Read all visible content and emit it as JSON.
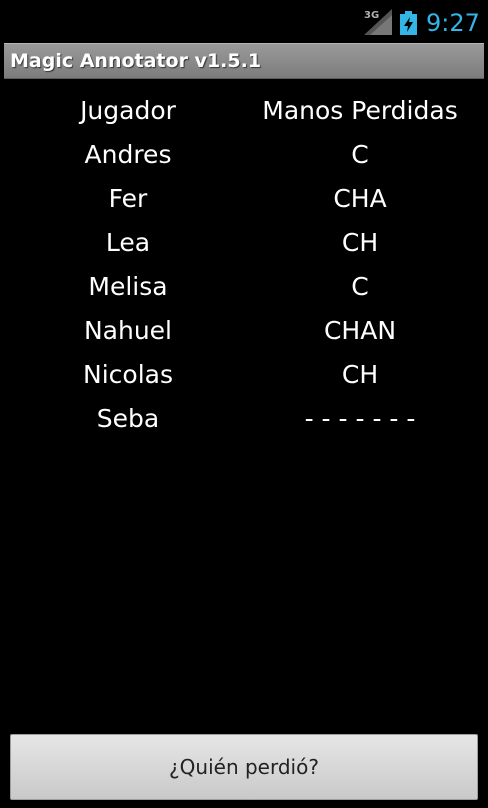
{
  "status_bar": {
    "network": "3G",
    "time": "9:27",
    "icons": [
      "signal-icon",
      "battery-charging-icon"
    ],
    "clock_color": "#33b5e5"
  },
  "app": {
    "title": "Magic Annotator v1.5.1"
  },
  "table": {
    "headers": [
      "Jugador",
      "Manos Perdidas"
    ],
    "rows": [
      {
        "player": "Andres",
        "hands": "C"
      },
      {
        "player": "Fer",
        "hands": "CHA"
      },
      {
        "player": "Lea",
        "hands": "CH"
      },
      {
        "player": "Melisa",
        "hands": "C"
      },
      {
        "player": "Nahuel",
        "hands": "CHAN"
      },
      {
        "player": "Nicolas",
        "hands": "CH"
      },
      {
        "player": "Seba",
        "hands": "- - - - - - -"
      }
    ]
  },
  "actions": {
    "who_lost_label": "¿Quién perdió?"
  }
}
